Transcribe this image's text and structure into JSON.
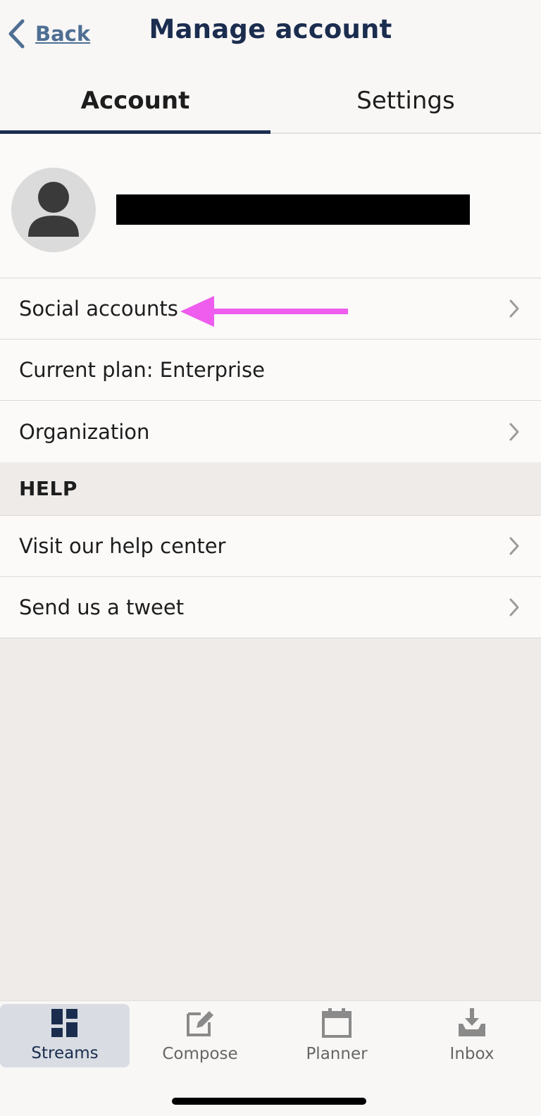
{
  "header": {
    "back_label": "Back",
    "title": "Manage account"
  },
  "tabs": [
    {
      "label": "Account",
      "active": true
    },
    {
      "label": "Settings",
      "active": false
    }
  ],
  "profile": {
    "avatar_icon": "user-avatar-icon",
    "name_redacted": true
  },
  "account_items": [
    {
      "label": "Social accounts",
      "chevron": true
    },
    {
      "label": "Current plan: Enterprise",
      "chevron": false
    },
    {
      "label": "Organization",
      "chevron": true
    }
  ],
  "help": {
    "section_title": "HELP",
    "items": [
      {
        "label": "Visit our help center",
        "chevron": true
      },
      {
        "label": "Send us a tweet",
        "chevron": true
      }
    ]
  },
  "annotation": {
    "color": "#ee5ded"
  },
  "bottom_nav": [
    {
      "label": "Streams",
      "icon": "streams-icon",
      "active": true
    },
    {
      "label": "Compose",
      "icon": "compose-icon",
      "active": false
    },
    {
      "label": "Planner",
      "icon": "planner-icon",
      "active": false
    },
    {
      "label": "Inbox",
      "icon": "inbox-icon",
      "active": false
    }
  ],
  "colors": {
    "brand": "#1b2d4f",
    "link": "#4f6f93"
  }
}
